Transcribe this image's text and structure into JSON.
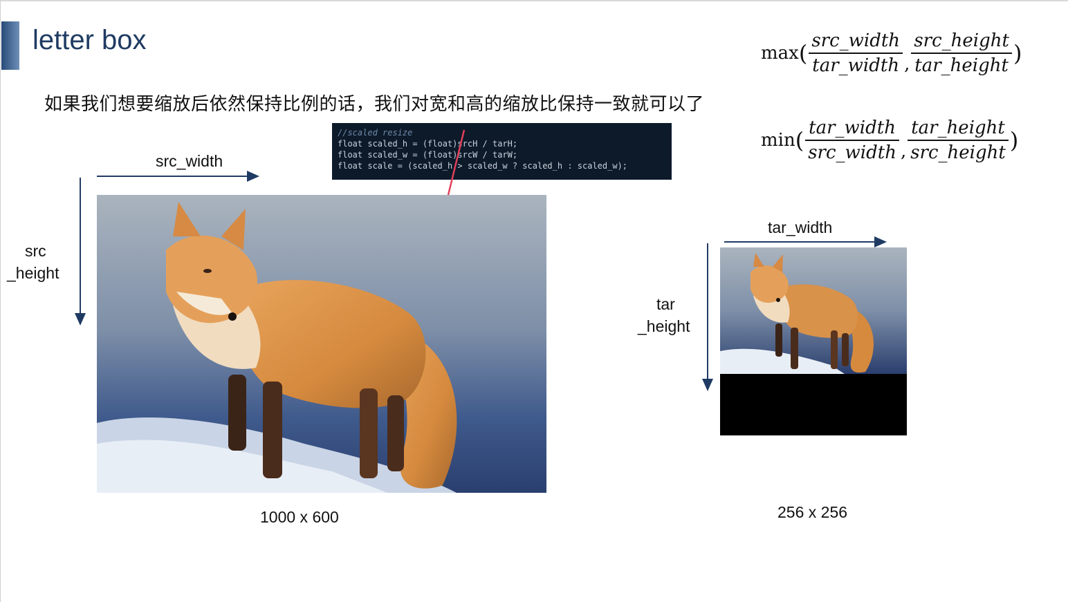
{
  "header": {
    "title": "letter box",
    "subtitle": "如果我们想要缩放后依然保持比例的话，我们对宽和高的缩放比保持一致就可以了"
  },
  "code_snippet": {
    "comment": "//scaled resize",
    "line1": "float scaled_h = (float)srcH / tarH;",
    "line2": "float scaled_w = (float)srcW / tarW;",
    "line3": "float scale = (scaled_h > scaled_w ? scaled_h : scaled_w);"
  },
  "source": {
    "width_label": "src_width",
    "height_label_1": "src",
    "height_label_2": "_height",
    "size_label": "1000 x 600"
  },
  "target": {
    "width_label": "tar_width",
    "height_label_1": "tar",
    "height_label_2": "_height",
    "size_label": "256 x 256"
  },
  "formulas": {
    "max": {
      "fn": "max",
      "num1": "src_width",
      "den1": "tar_width",
      "num2": "src_height",
      "den2": "tar_height"
    },
    "min": {
      "fn": "min",
      "num1": "tar_width",
      "den1": "src_width",
      "num2": "tar_height",
      "den2": "src_height"
    }
  },
  "colors": {
    "accent": "#1f3b63",
    "arrow": "#1f3b63",
    "pointer": "#e0405a"
  }
}
